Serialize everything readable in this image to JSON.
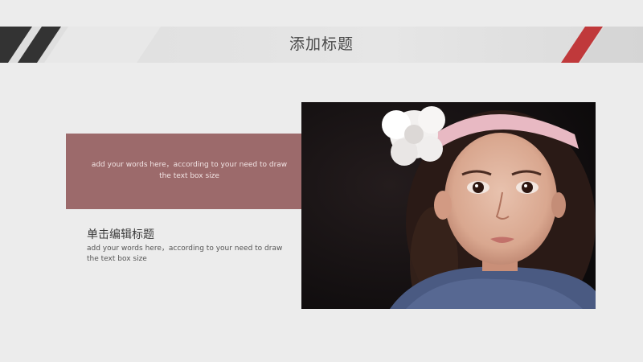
{
  "header": {
    "title": "添加标题"
  },
  "text_box": {
    "text_line1": "add your words here，according to your need to draw",
    "text_line2": "the text box size"
  },
  "section": {
    "title": "单击编辑标题",
    "desc_line1": "add your words here，according to your need to draw",
    "desc_line2": "the text box size"
  },
  "colors": {
    "accent_red": "#c0393b",
    "rose_box": "#9c6a6b",
    "rose_overlap": "#6a3136",
    "stripe_dark": "#333333"
  },
  "photo": {
    "subject": "girl-portrait-image"
  }
}
